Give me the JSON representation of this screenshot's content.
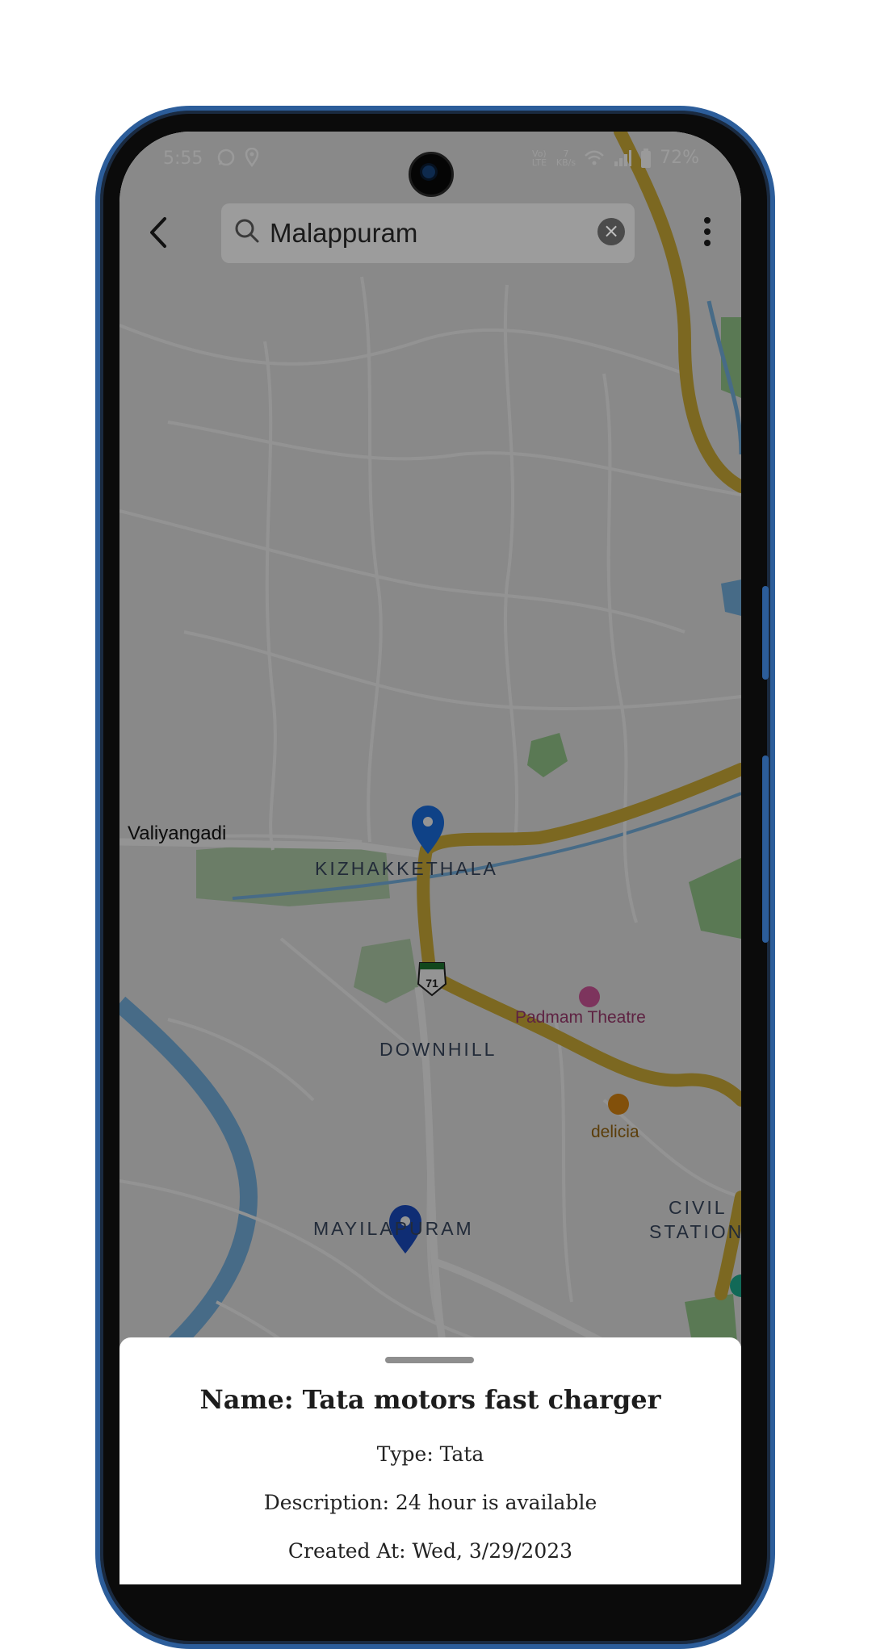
{
  "status_bar": {
    "time": "5:55",
    "net_type": "Vo) LTE",
    "speed_value": "7",
    "speed_unit": "KB/s",
    "battery": "72%"
  },
  "search": {
    "query": "Malappuram"
  },
  "map": {
    "labels": {
      "valiyangadi": "Valiyangadi",
      "kizhakkethala": "KIZHAKKETHALA",
      "highway_shield": "71",
      "padmam_theatre": "Padmam Theatre",
      "downhill": "DOWNHILL",
      "delicia": "delicia",
      "mayilapuram": "MAYILAPURAM",
      "civil": "CIVIL",
      "station": "STATION"
    }
  },
  "detail_sheet": {
    "title": "Name: Tata motors fast charger",
    "type": "Type: Tata",
    "description": "Description: 24 hour is available",
    "created_at": "Created At: Wed, 3/29/2023"
  },
  "colors": {
    "frame_accent": "#2c5d9a",
    "highway": "#d6b43a",
    "water": "#7bb8e8",
    "park": "#a7d3a0",
    "marker_blue": "#1a73e8"
  }
}
